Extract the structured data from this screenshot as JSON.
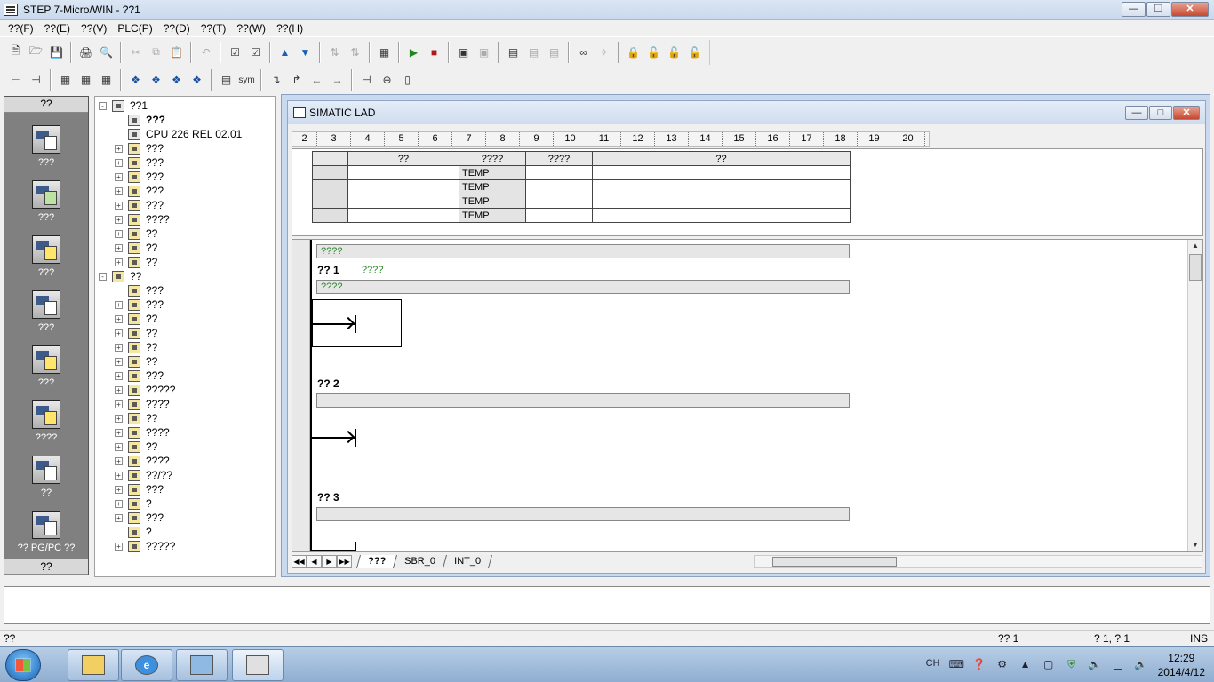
{
  "window": {
    "title": "STEP 7-Micro/WIN - ??1"
  },
  "menu": [
    "??(F)",
    "??(E)",
    "??(V)",
    "PLC(P)",
    "??(D)",
    "??(T)",
    "??(W)",
    "??(H)"
  ],
  "toolbar2": {
    "sym_label": "sym"
  },
  "navbar": {
    "header": "??",
    "footer": "??",
    "items": [
      "???",
      "???",
      "???",
      "???",
      "???",
      "????",
      "??",
      "?? PG/PC ??"
    ]
  },
  "tree": {
    "items": [
      {
        "label": "??1",
        "expander": "-",
        "indent": 0,
        "bold": false
      },
      {
        "label": "???",
        "expander": "",
        "indent": 1,
        "bold": true
      },
      {
        "label": "CPU 226 REL 02.01",
        "expander": "",
        "indent": 1,
        "bold": false
      },
      {
        "label": "???",
        "expander": "+",
        "indent": 1,
        "bold": false
      },
      {
        "label": "???",
        "expander": "+",
        "indent": 1,
        "bold": false
      },
      {
        "label": "???",
        "expander": "+",
        "indent": 1,
        "bold": false
      },
      {
        "label": "???",
        "expander": "+",
        "indent": 1,
        "bold": false
      },
      {
        "label": "???",
        "expander": "+",
        "indent": 1,
        "bold": false
      },
      {
        "label": "????",
        "expander": "+",
        "indent": 1,
        "bold": false
      },
      {
        "label": "??",
        "expander": "+",
        "indent": 1,
        "bold": false
      },
      {
        "label": "??",
        "expander": "+",
        "indent": 1,
        "bold": false
      },
      {
        "label": "??",
        "expander": "+",
        "indent": 1,
        "bold": false
      },
      {
        "label": "??",
        "expander": "-",
        "indent": 0,
        "bold": false
      },
      {
        "label": "???",
        "expander": "",
        "indent": 1,
        "bold": false
      },
      {
        "label": "???",
        "expander": "+",
        "indent": 1,
        "bold": false
      },
      {
        "label": "??",
        "expander": "+",
        "indent": 1,
        "bold": false
      },
      {
        "label": "??",
        "expander": "+",
        "indent": 1,
        "bold": false
      },
      {
        "label": "??",
        "expander": "+",
        "indent": 1,
        "bold": false
      },
      {
        "label": "??",
        "expander": "+",
        "indent": 1,
        "bold": false
      },
      {
        "label": "???",
        "expander": "+",
        "indent": 1,
        "bold": false
      },
      {
        "label": "?????",
        "expander": "+",
        "indent": 1,
        "bold": false
      },
      {
        "label": "????",
        "expander": "+",
        "indent": 1,
        "bold": false
      },
      {
        "label": "??",
        "expander": "+",
        "indent": 1,
        "bold": false
      },
      {
        "label": "????",
        "expander": "+",
        "indent": 1,
        "bold": false
      },
      {
        "label": "??",
        "expander": "+",
        "indent": 1,
        "bold": false
      },
      {
        "label": "????",
        "expander": "+",
        "indent": 1,
        "bold": false
      },
      {
        "label": "??/??",
        "expander": "+",
        "indent": 1,
        "bold": false
      },
      {
        "label": "???",
        "expander": "+",
        "indent": 1,
        "bold": false
      },
      {
        "label": "?",
        "expander": "+",
        "indent": 1,
        "bold": false
      },
      {
        "label": "???",
        "expander": "+",
        "indent": 1,
        "bold": false
      },
      {
        "label": "?",
        "expander": "",
        "indent": 1,
        "bold": false
      },
      {
        "label": "?????",
        "expander": "+",
        "indent": 1,
        "bold": false
      }
    ]
  },
  "lad_window": {
    "title": "SIMATIC LAD",
    "ruler": [
      "2",
      "3",
      "4",
      "5",
      "6",
      "7",
      "8",
      "9",
      "10",
      "11",
      "12",
      "13",
      "14",
      "15",
      "16",
      "17",
      "18",
      "19",
      "20"
    ],
    "var_table": {
      "headers": [
        "??",
        "????",
        "????",
        "??"
      ],
      "rows": [
        [
          "",
          "TEMP",
          "",
          ""
        ],
        [
          "",
          "TEMP",
          "",
          ""
        ],
        [
          "",
          "TEMP",
          "",
          ""
        ],
        [
          "",
          "TEMP",
          "",
          ""
        ]
      ]
    },
    "program_comment": "????",
    "networks": [
      {
        "label": "?? 1",
        "title": "????",
        "comment": "????"
      },
      {
        "label": "?? 2",
        "title": "",
        "comment": ""
      },
      {
        "label": "?? 3",
        "title": "",
        "comment": ""
      }
    ],
    "tabs": [
      "???",
      "SBR_0",
      "INT_0"
    ]
  },
  "statusbar": {
    "left": "??",
    "network": "?? 1",
    "position": "? 1, ? 1",
    "mode": "INS"
  },
  "taskbar": {
    "tray_lang": "CH",
    "time": "12:29",
    "date": "2014/4/12"
  }
}
